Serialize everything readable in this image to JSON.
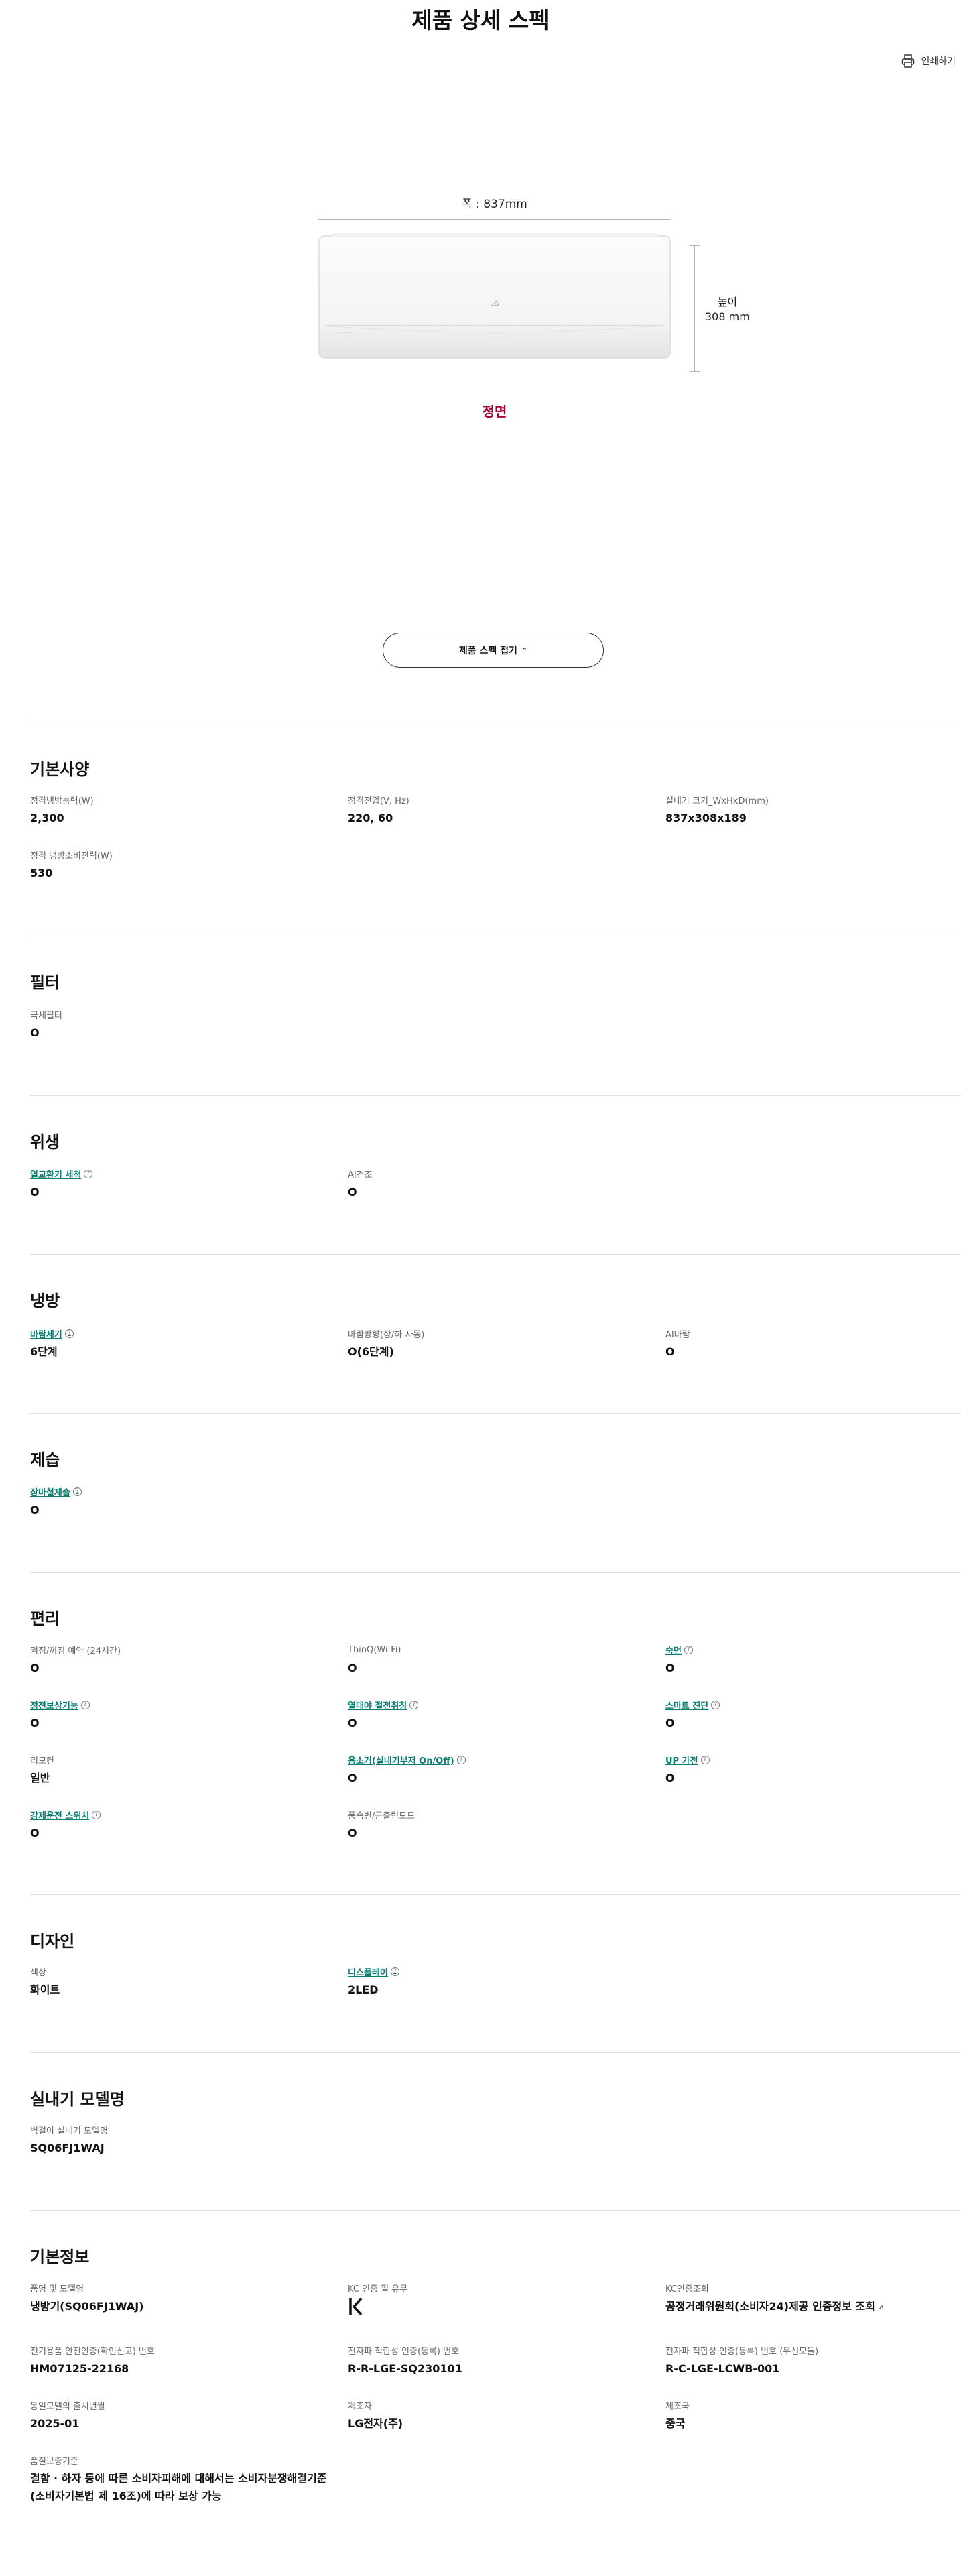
{
  "page": {
    "title": "제품 상세 스펙",
    "print_label": "인쇄하기"
  },
  "product_image": {
    "width_label": "폭 : 837mm",
    "height_label_1": "높이",
    "height_label_2": "308 mm",
    "view_label": "정면",
    "brand_mark": "LG"
  },
  "collapse_button": {
    "label": "제품 스펙 접기",
    "icon": "chevron-up-icon"
  },
  "sections": {
    "basic": {
      "title": "기본사양",
      "specs": [
        {
          "label": "정격냉방능력(W)",
          "value": "2,300"
        },
        {
          "label": "정격전압(V, Hz)",
          "value": "220, 60"
        },
        {
          "label": "실내기 크기_WxHxD(mm)",
          "value": "837x308x189"
        },
        {
          "label": "정격 냉방소비전력(W)",
          "value": "530"
        }
      ]
    },
    "filter": {
      "title": "필터",
      "specs": [
        {
          "label": "극세필터",
          "value": "O"
        }
      ]
    },
    "hygiene": {
      "title": "위생",
      "specs": [
        {
          "label": "열교환기 세척",
          "value": "O"
        },
        {
          "label": "AI건조",
          "value": "O"
        }
      ]
    },
    "cooling": {
      "title": "냉방",
      "specs": [
        {
          "label": "바람세기",
          "value": "6단계"
        },
        {
          "label": "바람방향(상/하 자동)",
          "value": "O(6단계)"
        },
        {
          "label": "AI바람",
          "value": "O"
        }
      ]
    },
    "dehumid": {
      "title": "제습",
      "specs": [
        {
          "label": "장마철제습",
          "value": "O"
        }
      ]
    },
    "convenience": {
      "title": "편리",
      "specs": [
        {
          "label": "켜짐/꺼짐 예약 (24시간)",
          "value": "O"
        },
        {
          "label": "ThinQ(Wi-Fi)",
          "value": "O"
        },
        {
          "label": "숙면",
          "value": "O"
        },
        {
          "label": "정전보상기능",
          "value": "O"
        },
        {
          "label": "열대야 절전취침",
          "value": "O"
        },
        {
          "label": "스마트 진단",
          "value": "O"
        },
        {
          "label": "리모컨",
          "value": "일반"
        },
        {
          "label": "음소거(실내기부저 On/Off)",
          "value": "O"
        },
        {
          "label": "UP 가전",
          "value": "O"
        },
        {
          "label": "강제운전 스위치",
          "value": "O"
        },
        {
          "label": "풍속변/군출림모드",
          "value": "O"
        }
      ]
    },
    "design": {
      "title": "디자인",
      "specs": [
        {
          "label": "색상",
          "value": "화이트"
        },
        {
          "label": "디스플레이",
          "value": "2LED"
        }
      ]
    },
    "model": {
      "title": "실내기 모델명",
      "specs": [
        {
          "label": "벽걸이 실내기 모델명",
          "value": "SQ06FJ1WAJ"
        }
      ]
    },
    "info": {
      "title": "기본정보",
      "specs": [
        {
          "label": "품명 및 모델명",
          "value": "냉방기(SQ06FJ1WAJ)"
        },
        {
          "label": "KC 인증 필 유무",
          "value": ""
        },
        {
          "label": "KC인증조회",
          "value": "공정거래위원회(소비자24)제공 인증정보 조회"
        },
        {
          "label": "전기용품 안전인증(확인신고) 번호",
          "value": "HM07125-22168"
        },
        {
          "label": "전자파 적합성 인증(등록) 번호",
          "value": "R-R-LGE-SQ230101"
        },
        {
          "label": "전자파 적합성 인증(등록) 번호 (무선모듈)",
          "value": "R-C-LGE-LCWB-001"
        },
        {
          "label": "동일모델의 출시년월",
          "value": "2025-01"
        },
        {
          "label": "제조자",
          "value": "LG전자(주)"
        },
        {
          "label": "제조국",
          "value": "중국"
        },
        {
          "label": "품질보증기준",
          "value_line1": "결함 · 하자 등에 따른 소비자피해에 대해서는 소비자분쟁해결기준",
          "value_line2": "(소비자기본법 제 16조)에 따라 보상 가능"
        }
      ]
    }
  },
  "colors": {
    "accent": "#a50034",
    "link": "#0b7d71"
  }
}
